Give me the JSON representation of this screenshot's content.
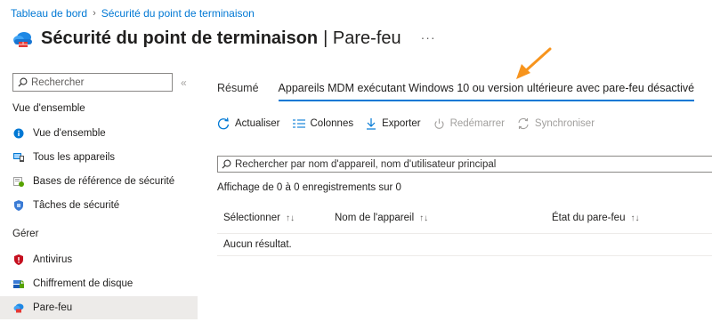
{
  "breadcrumb": {
    "home": "Tableau de bord",
    "current": "Sécurité du point de terminaison"
  },
  "header": {
    "title": "Sécurité du point de terminaison",
    "subtitle": "| Pare-feu",
    "more": "···"
  },
  "sidebar": {
    "search_placeholder": "Rechercher",
    "collapse": "«",
    "sections": [
      {
        "heading": "Vue d'ensemble",
        "items": [
          {
            "label": "Vue d'ensemble",
            "icon": "info-icon"
          },
          {
            "label": "Tous les appareils",
            "icon": "devices-icon"
          },
          {
            "label": "Bases de référence de sécurité",
            "icon": "baseline-icon"
          },
          {
            "label": "Tâches de sécurité",
            "icon": "shield-tasks-icon"
          }
        ]
      },
      {
        "heading": "Gérer",
        "items": [
          {
            "label": "Antivirus",
            "icon": "antivirus-shield-icon"
          },
          {
            "label": "Chiffrement de disque",
            "icon": "disk-encryption-icon"
          },
          {
            "label": "Pare-feu",
            "icon": "firewall-cloud-icon",
            "active": true
          }
        ]
      }
    ]
  },
  "tabs": [
    {
      "label": "Résumé"
    },
    {
      "label": "Appareils MDM exécutant Windows 10 ou version ultérieure avec pare-feu désactivé",
      "selected": true
    }
  ],
  "toolbar": {
    "refresh": "Actualiser",
    "columns": "Colonnes",
    "export": "Exporter",
    "restart": "Redémarrer",
    "sync": "Synchroniser"
  },
  "search": {
    "placeholder": "Rechercher par nom d'appareil, nom d'utilisateur principal"
  },
  "records": {
    "text": "Affichage de 0 à 0 enregistrements sur 0"
  },
  "table": {
    "columns": [
      {
        "label": "Sélectionner",
        "sort": "↑↓"
      },
      {
        "label": "Nom de l'appareil",
        "sort": "↑↓"
      },
      {
        "label": "État du pare-feu",
        "sort": "↑↓"
      }
    ],
    "empty": "Aucun résultat."
  },
  "colors": {
    "accent": "#0078d4",
    "annotation_arrow": "#f7941d",
    "active_bg": "#edebe9"
  }
}
